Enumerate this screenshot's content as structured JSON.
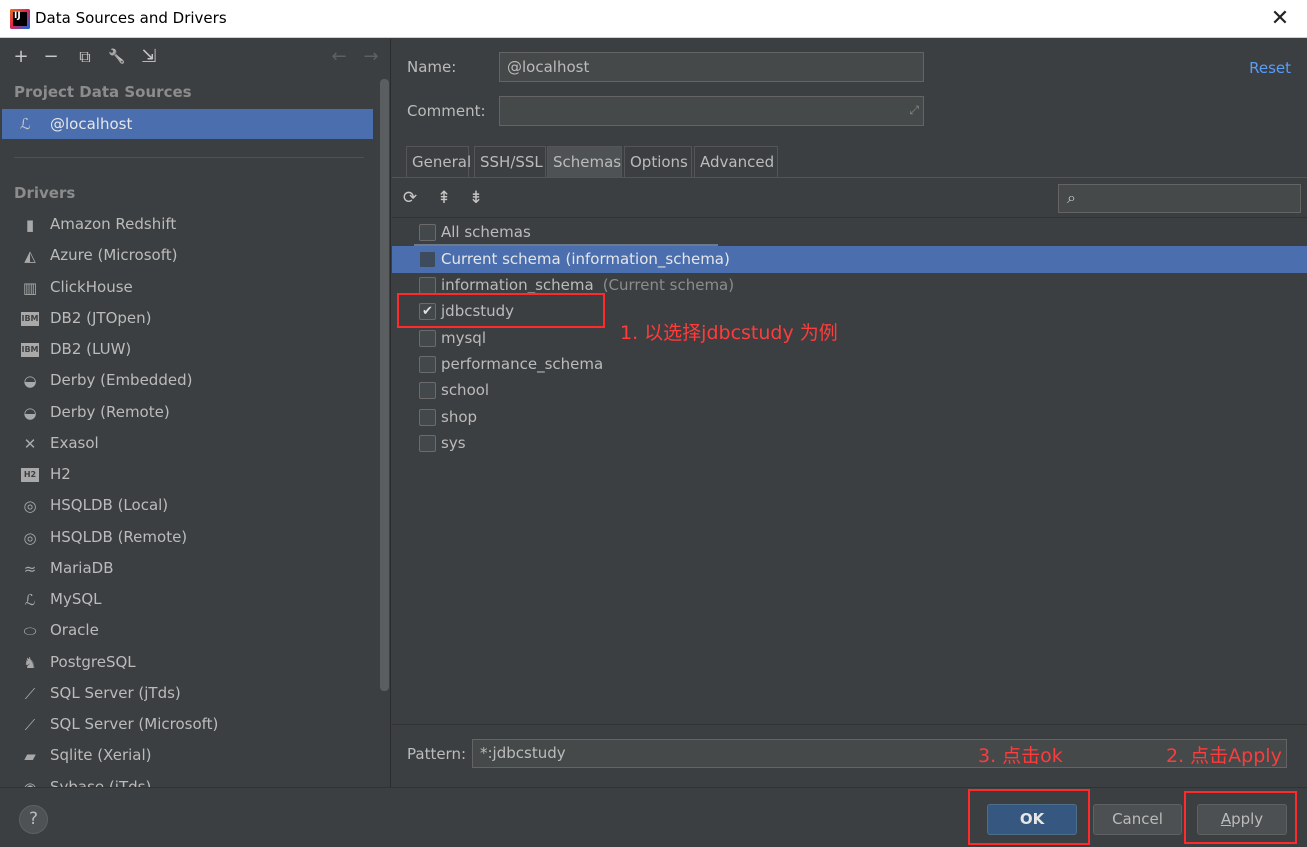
{
  "window": {
    "app_icon_text": "IJ",
    "title": "Data Sources and Drivers",
    "close_glyph": "✕"
  },
  "left_toolbar": {
    "add": "+",
    "remove": "−",
    "duplicate": "⧉",
    "properties": "🔧",
    "import": "⇲",
    "back": "←",
    "forward": "→"
  },
  "sections": {
    "project_data_sources": "Project Data Sources",
    "drivers": "Drivers"
  },
  "selected_source": {
    "icon": "mysql-dolphin-icon",
    "label": "@localhost"
  },
  "drivers": [
    {
      "icon": "amazon-redshift-icon",
      "glyph": "▮",
      "label": "Amazon Redshift"
    },
    {
      "icon": "azure-icon",
      "glyph": "◭",
      "label": "Azure (Microsoft)"
    },
    {
      "icon": "clickhouse-icon",
      "glyph": "▥",
      "label": "ClickHouse"
    },
    {
      "icon": "ibm-db2-icon",
      "glyph": "IBM",
      "box": true,
      "label": "DB2 (JTOpen)"
    },
    {
      "icon": "ibm-db2-icon",
      "glyph": "IBM",
      "box": true,
      "label": "DB2 (LUW)"
    },
    {
      "icon": "derby-hat-icon",
      "glyph": "◒",
      "label": "Derby (Embedded)"
    },
    {
      "icon": "derby-hat-icon",
      "glyph": "◒",
      "label": "Derby (Remote)"
    },
    {
      "icon": "exasol-icon",
      "glyph": "✕",
      "label": "Exasol"
    },
    {
      "icon": "h2-icon",
      "glyph": "H2",
      "box": true,
      "label": "H2"
    },
    {
      "icon": "hsqldb-icon",
      "glyph": "◎",
      "label": "HSQLDB (Local)"
    },
    {
      "icon": "hsqldb-icon",
      "glyph": "◎",
      "label": "HSQLDB (Remote)"
    },
    {
      "icon": "mariadb-seal-icon",
      "glyph": "≈",
      "label": "MariaDB"
    },
    {
      "icon": "mysql-dolphin-icon",
      "glyph": "ℒ",
      "label": "MySQL"
    },
    {
      "icon": "oracle-icon",
      "glyph": "⬭",
      "label": "Oracle"
    },
    {
      "icon": "postgresql-elephant-icon",
      "glyph": "♞",
      "label": "PostgreSQL"
    },
    {
      "icon": "sql-server-icon",
      "glyph": "⟋",
      "label": "SQL Server (jTds)"
    },
    {
      "icon": "sql-server-icon",
      "glyph": "⟋",
      "label": "SQL Server (Microsoft)"
    },
    {
      "icon": "sqlite-feather-icon",
      "glyph": "▰",
      "label": "Sqlite (Xerial)"
    },
    {
      "icon": "sybase-icon",
      "glyph": "◉",
      "label": "Sybase (jTds)"
    }
  ],
  "form": {
    "name_label": "Name:",
    "name_value": "@localhost",
    "comment_label": "Comment:",
    "comment_value": "",
    "reset_label": "Reset",
    "expand_glyph": "⤢"
  },
  "tabs": [
    {
      "label": "General"
    },
    {
      "label": "SSH/SSL"
    },
    {
      "label": "Schemas",
      "active": true
    },
    {
      "label": "Options"
    },
    {
      "label": "Advanced"
    }
  ],
  "schema_toolbar": {
    "refresh": "⟳",
    "expand_all": "⇞",
    "collapse_all": "⇟",
    "search_glyph": "⌕",
    "search_value": ""
  },
  "schemas": [
    {
      "label": "All schemas",
      "checked": false
    },
    {
      "label": "Current schema (information_schema)",
      "checked": false,
      "selected": true
    },
    {
      "label": "information_schema",
      "hint": "(Current schema)",
      "checked": false
    },
    {
      "label": "jdbcstudy",
      "checked": true
    },
    {
      "label": "mysql",
      "checked": false
    },
    {
      "label": "performance_schema",
      "checked": false
    },
    {
      "label": "school",
      "checked": false
    },
    {
      "label": "shop",
      "checked": false
    },
    {
      "label": "sys",
      "checked": false
    }
  ],
  "pattern": {
    "label": "Pattern:",
    "value": "*:jdbcstudy"
  },
  "buttons": {
    "help": "?",
    "ok": "OK",
    "cancel": "Cancel",
    "apply_first": "A",
    "apply_rest": "pply"
  },
  "annotations": {
    "step1": "1. 以选择jdbcstudy 为例",
    "step2": "2. 点击Apply",
    "step3": "3. 点击ok",
    "color": "#ff2b2b"
  }
}
